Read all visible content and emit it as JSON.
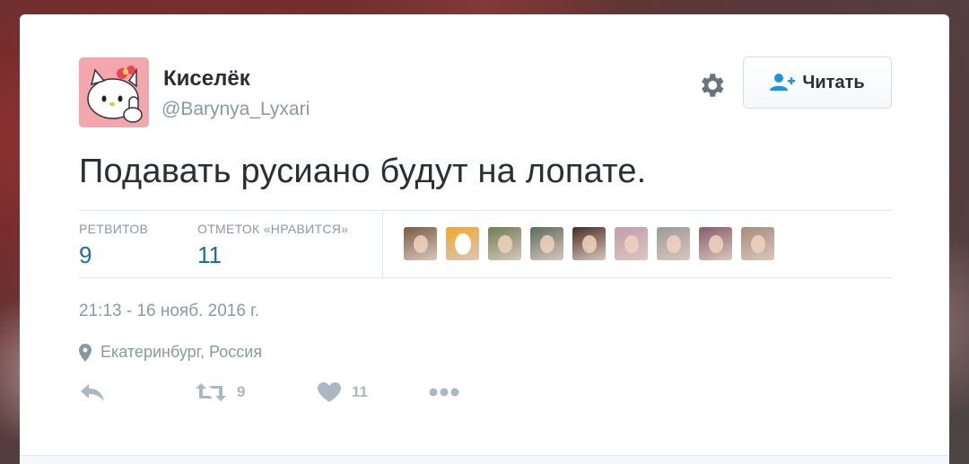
{
  "tweet": {
    "author": {
      "display_name": "Киселёк",
      "screen_name": "@Barynya_Lyxari",
      "avatar_icon": "hello-kitty-avatar"
    },
    "follow_button": {
      "label": "Читать",
      "icon": "add-user-icon"
    },
    "settings_icon": "gear-icon",
    "text": "Подавать русиано будут на лопате.",
    "stats": {
      "retweets_label": "РЕТВИТОВ",
      "retweets_count": "9",
      "likes_label": "ОТМЕТОК «НРАВИТСЯ»",
      "likes_count": "11"
    },
    "likers": [
      {
        "name": "liker-1",
        "color": "#7b5a44"
      },
      {
        "name": "liker-2",
        "color": "#f5a623"
      },
      {
        "name": "liker-3",
        "color": "#6e7d55"
      },
      {
        "name": "liker-4",
        "color": "#5d6b5e"
      },
      {
        "name": "liker-5",
        "color": "#4a2b25"
      },
      {
        "name": "liker-6",
        "color": "#c79ab0"
      },
      {
        "name": "liker-7",
        "color": "#9a9a9a"
      },
      {
        "name": "liker-8",
        "color": "#8a5a6a"
      },
      {
        "name": "liker-9",
        "color": "#a88a7a"
      }
    ],
    "timestamp": "21:13 - 16 нояб. 2016 г.",
    "location": "Екатеринбург, Россия",
    "actions": {
      "retweet_count": "9",
      "like_count": "11"
    },
    "colors": {
      "link_blue": "#1b6ea6",
      "muted_gray": "#8899a6",
      "icon_gray": "#aab8c2",
      "text_dark": "#292f33"
    }
  }
}
